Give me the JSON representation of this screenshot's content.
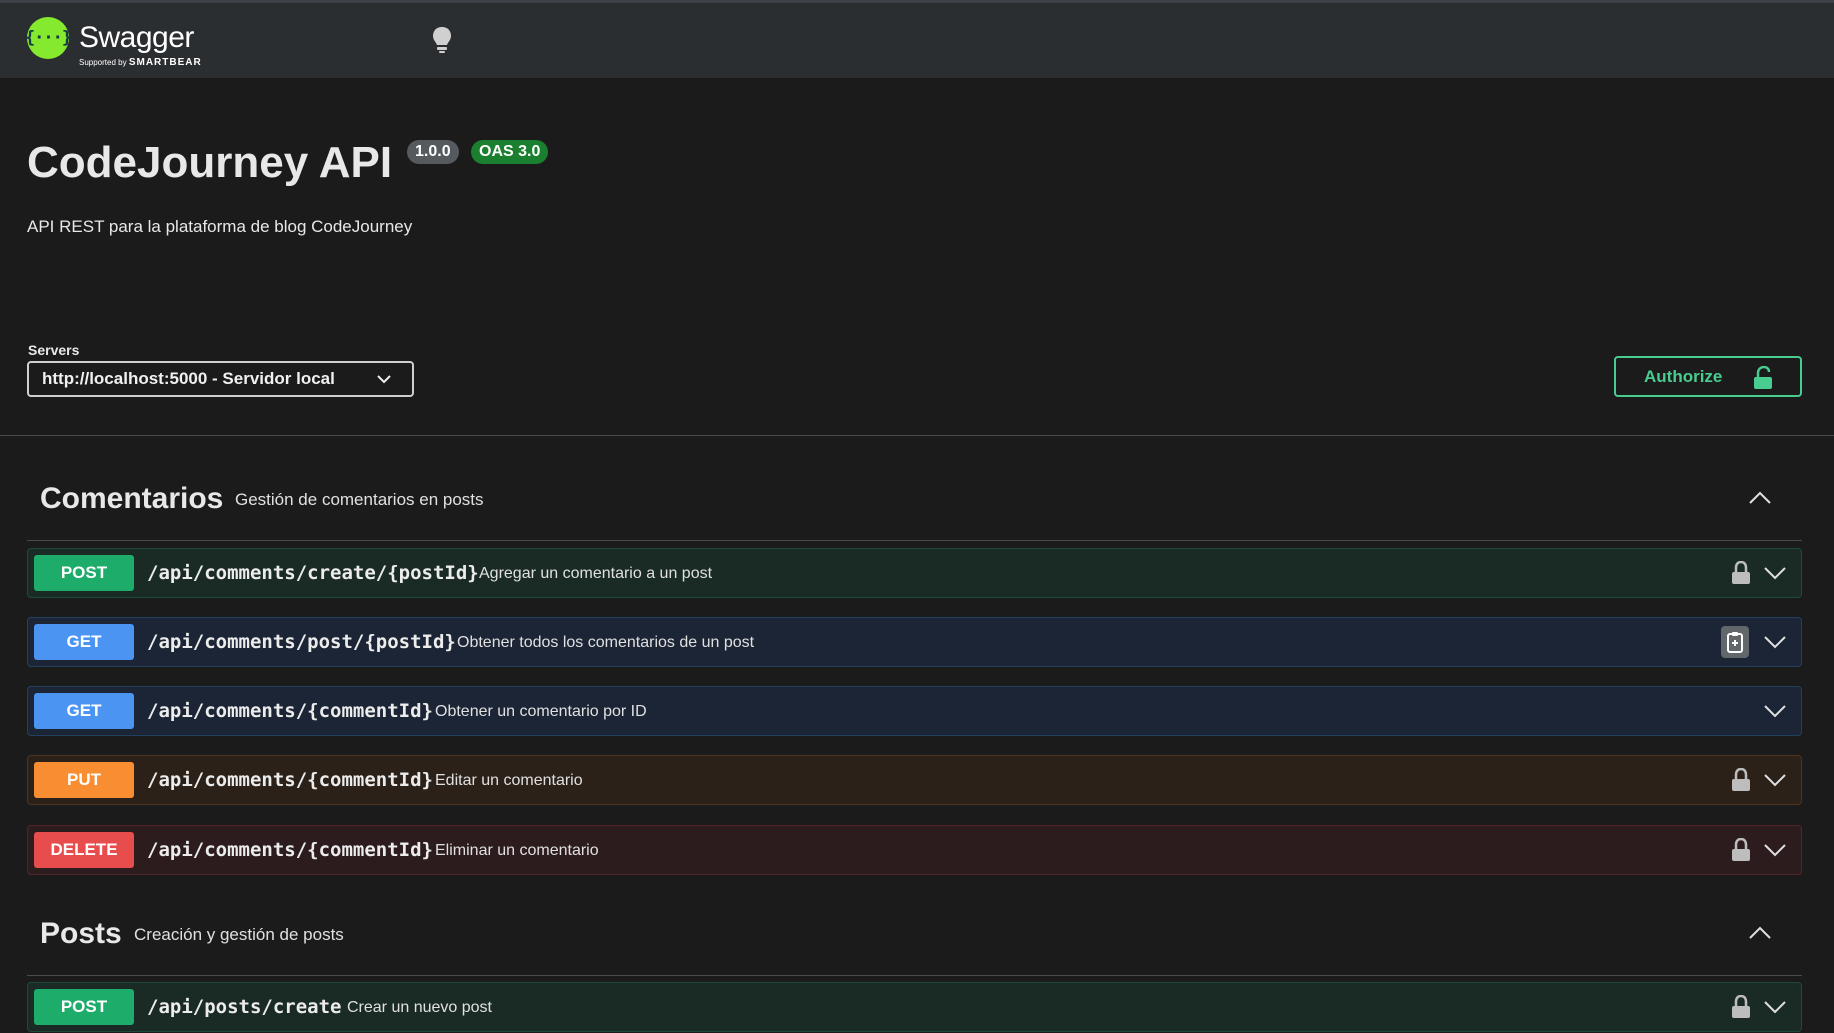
{
  "topbar": {
    "brand": "Swagger",
    "brand_sub_prefix": "Supported by",
    "brand_sub_company": "SMARTBEAR",
    "logo_glyph": "{···}"
  },
  "info": {
    "title": "CodeJourney API",
    "version": "1.0.0",
    "oas": "OAS 3.0",
    "description": "API REST para la plataforma de blog CodeJourney"
  },
  "servers": {
    "label": "Servers",
    "selected": "http://localhost:5000 - Servidor local"
  },
  "authorize": {
    "label": "Authorize"
  },
  "sections": [
    {
      "name": "Comentarios",
      "description": "Gestión de comentarios en posts",
      "operations": [
        {
          "method": "POST",
          "path": "/api/comments/create/{postId}",
          "summary": "Agregar un comentario a un post",
          "icon": "lock-icon"
        },
        {
          "method": "GET",
          "path": "/api/comments/post/{postId}",
          "summary": "Obtener todos los comentarios de un post",
          "icon": "copy-icon"
        },
        {
          "method": "GET",
          "path": "/api/comments/{commentId}",
          "summary": "Obtener un comentario por ID",
          "icon": ""
        },
        {
          "method": "PUT",
          "path": "/api/comments/{commentId}",
          "summary": "Editar un comentario",
          "icon": "lock-icon"
        },
        {
          "method": "DELETE",
          "path": "/api/comments/{commentId}",
          "summary": "Eliminar un comentario",
          "icon": "lock-icon"
        }
      ]
    },
    {
      "name": "Posts",
      "description": "Creación y gestión de posts",
      "operations": [
        {
          "method": "POST",
          "path": "/api/posts/create",
          "summary": "Crear un nuevo post",
          "icon": "lock-icon"
        }
      ]
    }
  ],
  "colors": {
    "post": "#1eac6b",
    "get": "#4c94f2",
    "put": "#f98d31",
    "delete": "#e84d4d",
    "authorize": "#49cc90",
    "swagger_green": "#85ea2d"
  }
}
